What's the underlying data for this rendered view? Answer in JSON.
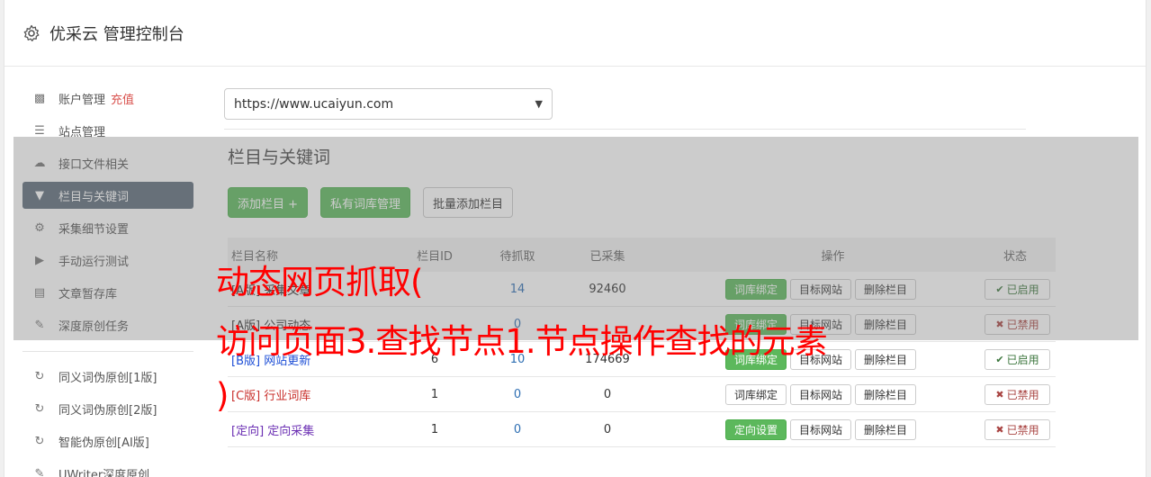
{
  "header": {
    "title": "优采云 管理控制台",
    "icon": "gear-icon"
  },
  "sidebar": {
    "items": [
      {
        "label": "账户管理",
        "extra": "充值",
        "icon": "bar-chart-icon"
      },
      {
        "label": "站点管理",
        "icon": "server-icon"
      },
      {
        "label": "接口文件相关",
        "icon": "cloud-upload-icon"
      },
      {
        "label": "栏目与关键词",
        "icon": "filter-icon"
      },
      {
        "label": "采集细节设置",
        "icon": "gears-icon"
      },
      {
        "label": "手动运行测试",
        "icon": "play-circle-icon"
      },
      {
        "label": "文章暂存库",
        "icon": "database-icon"
      },
      {
        "label": "深度原创任务",
        "icon": "edit-icon"
      },
      {
        "label": "同义词伪原创[1版]",
        "icon": "refresh-icon"
      },
      {
        "label": "同义词伪原创[2版]",
        "icon": "refresh-icon"
      },
      {
        "label": "智能伪原创[AI版]",
        "icon": "refresh-icon"
      },
      {
        "label": "UWriter深度原创",
        "icon": "edit-icon"
      }
    ],
    "active_index": 3,
    "active_color": "#5c6b7a",
    "recharge_color": "#d9534f"
  },
  "main": {
    "site_select": {
      "value": "https://www.ucaiyun.com"
    },
    "section_title": "栏目与关键词",
    "buttons": {
      "add_column": "添加栏目 +",
      "private_lib": "私有词库管理",
      "batch_add": "批量添加栏目"
    },
    "table": {
      "headers": {
        "name": "栏目名称",
        "id": "栏目ID",
        "pending": "待抓取",
        "collected": "已采集",
        "ops": "操作",
        "status": "状态"
      },
      "rows": [
        {
          "tag": "[A版]",
          "name": "采集文章",
          "id": "",
          "pending": "14",
          "collected": "92460",
          "op1": "词库绑定",
          "op1_green": true,
          "op2": "目标网站",
          "op3": "删除栏目",
          "status": "已启用",
          "enabled": true
        },
        {
          "tag": "[A版]",
          "name": "公司动态",
          "id": "",
          "pending": "0",
          "collected": "",
          "op1": "词库绑定",
          "op1_green": true,
          "op2": "目标网站",
          "op3": "删除栏目",
          "status": "已禁用",
          "enabled": false
        },
        {
          "tag": "[B版]",
          "name": "网站更新",
          "id": "6",
          "pending": "10",
          "collected": "174669",
          "op1": "词库绑定",
          "op1_green": true,
          "op2": "目标网站",
          "op3": "删除栏目",
          "status": "已启用",
          "enabled": true
        },
        {
          "tag": "[C版]",
          "name": "行业词库",
          "id": "1",
          "pending": "0",
          "collected": "0",
          "op1": "词库绑定",
          "op1_green": false,
          "op2": "目标网站",
          "op3": "删除栏目",
          "status": "已禁用",
          "enabled": false
        },
        {
          "tag": "[定向]",
          "name": "定向采集",
          "id": "1",
          "pending": "0",
          "collected": "0",
          "op1": "定向设置",
          "op1_green": true,
          "op2": "目标网站",
          "op3": "删除栏目",
          "status": "已禁用",
          "enabled": false
        }
      ]
    }
  },
  "watermark": {
    "lines": [
      "动态网页抓取(",
      "访问页面3.查找节点1.节点操作查找的元素",
      ")"
    ],
    "color": "#ff0000"
  }
}
